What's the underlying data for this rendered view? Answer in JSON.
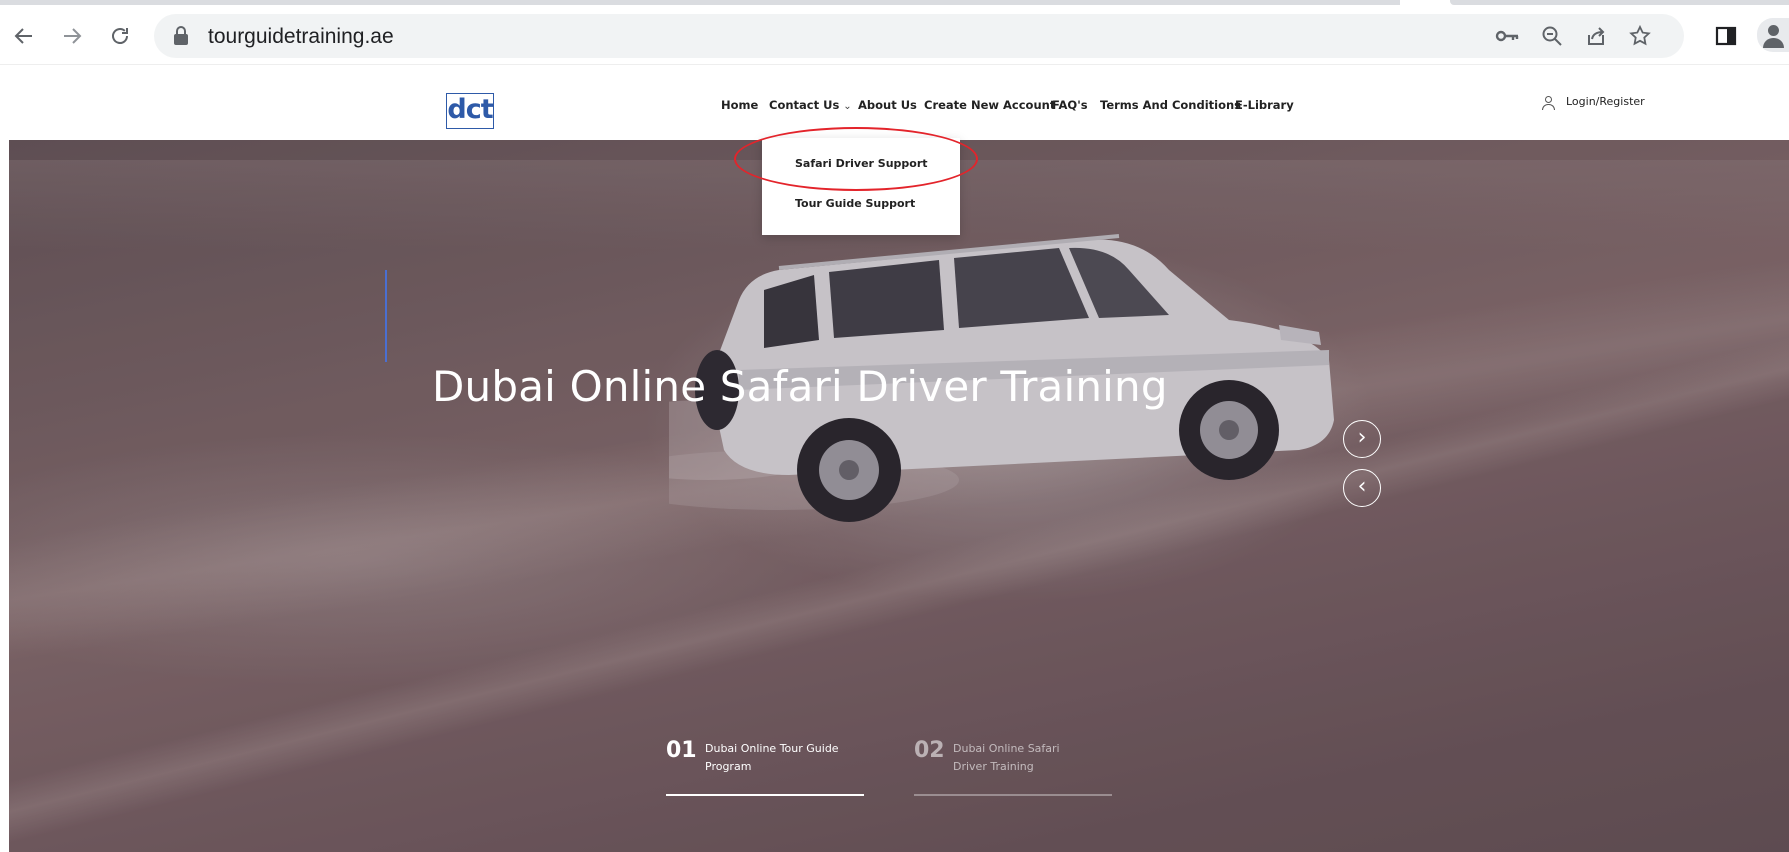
{
  "browser": {
    "url": "tourguidetraining.ae",
    "icons": [
      "back-arrow-icon",
      "forward-arrow-icon",
      "reload-icon",
      "lock-icon",
      "key-icon",
      "zoom-out-icon",
      "share-icon",
      "star-icon",
      "side-panel-icon",
      "profile-icon"
    ]
  },
  "site": {
    "logo_text": "dct",
    "nav": {
      "home": "Home",
      "contact": "Contact Us",
      "about": "About Us",
      "create_account": "Create New Account",
      "faq": "FAQ's",
      "terms": "Terms And Conditions",
      "elibrary": "E-Library",
      "login": "Login/Register"
    },
    "dropdown": {
      "items": [
        "Safari Driver Support",
        "Tour Guide Support"
      ]
    }
  },
  "hero": {
    "title": "Dubai Online Safari Driver Training",
    "slides": [
      {
        "num": "01",
        "label": "Dubai Online Tour Guide Program",
        "active": true
      },
      {
        "num": "02",
        "label": "Dubai Online Safari Driver Training",
        "active": false
      }
    ]
  },
  "colors": {
    "accent": "#4a6fd1",
    "annotation": "#e3242b",
    "logo": "#2e5aa8"
  }
}
